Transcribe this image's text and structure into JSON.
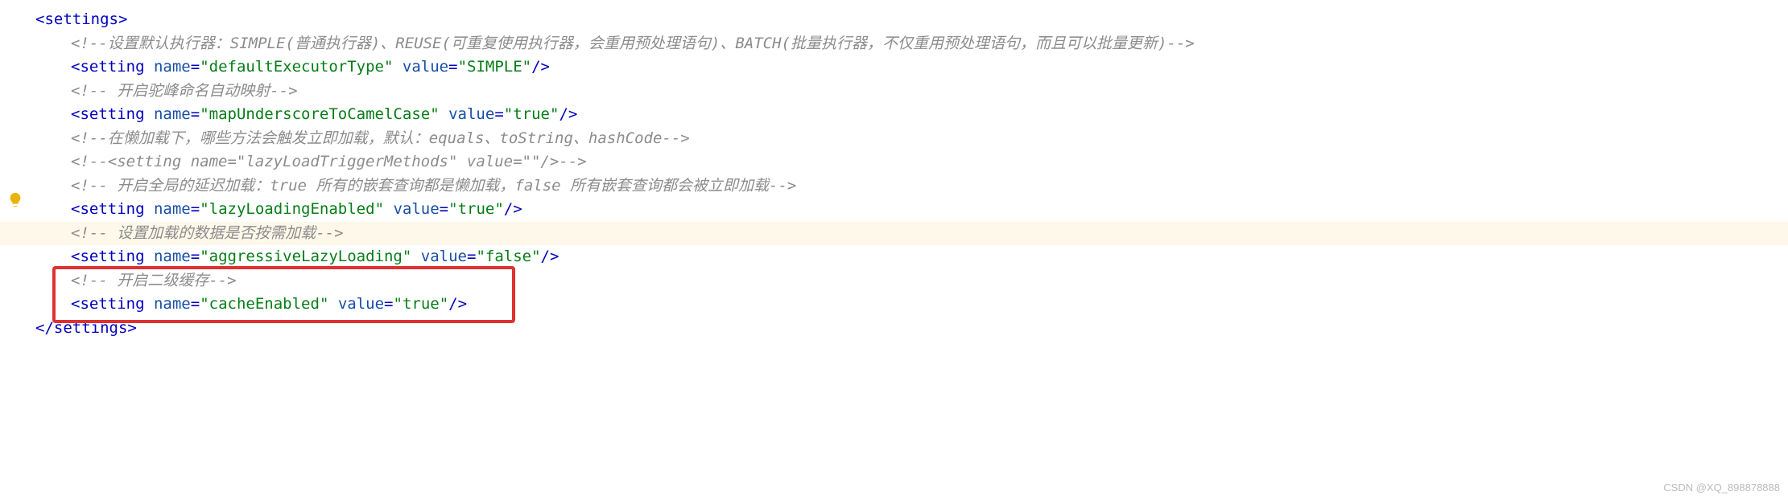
{
  "code": {
    "openTag": "<settings>",
    "closeTag": "</settings>",
    "comments": {
      "executor": "<!--设置默认执行器：SIMPLE(普通执行器)、REUSE(可重复使用执行器，会重用预处理语句)、BATCH(批量执行器，不仅重用预处理语句，而且可以批量更新)-->",
      "camel": "<!--    开启驼峰命名自动映射-->",
      "lazyTrig": "<!--在懒加载下，哪些方法会触发立即加载，默认：equals、toString、hashCode-->",
      "lazyTrigCommented": "<!--<setting name=\"lazyLoadTriggerMethods\" value=\"\"/>-->",
      "lazyGlobal": "<!--    开启全局的延迟加载：true 所有的嵌套查询都是懒加载，false 所有嵌套查询都会被立即加载-->",
      "onDemand": "<!--    设置加载的数据是否按需加载-->",
      "cache": "<!--    开启二级缓存-->"
    },
    "settings": {
      "s1": {
        "tag": "setting",
        "attrName": "name",
        "nameVal": "defaultExecutorType",
        "attrValue": "value",
        "valueVal": "SIMPLE"
      },
      "s2": {
        "tag": "setting",
        "attrName": "name",
        "nameVal": "mapUnderscoreToCamelCase",
        "attrValue": "value",
        "valueVal": "true"
      },
      "s3": {
        "tag": "setting",
        "attrName": "name",
        "nameVal": "lazyLoadingEnabled",
        "attrValue": "value",
        "valueVal": "true"
      },
      "s4": {
        "tag": "setting",
        "attrName": "name",
        "nameVal": "aggressiveLazyLoading",
        "attrValue": "value",
        "valueVal": "false"
      },
      "s5": {
        "tag": "setting",
        "attrName": "name",
        "nameVal": "cacheEnabled",
        "attrValue": "value",
        "valueVal": "true"
      }
    }
  },
  "watermark": "CSDN @XQ_898878888"
}
